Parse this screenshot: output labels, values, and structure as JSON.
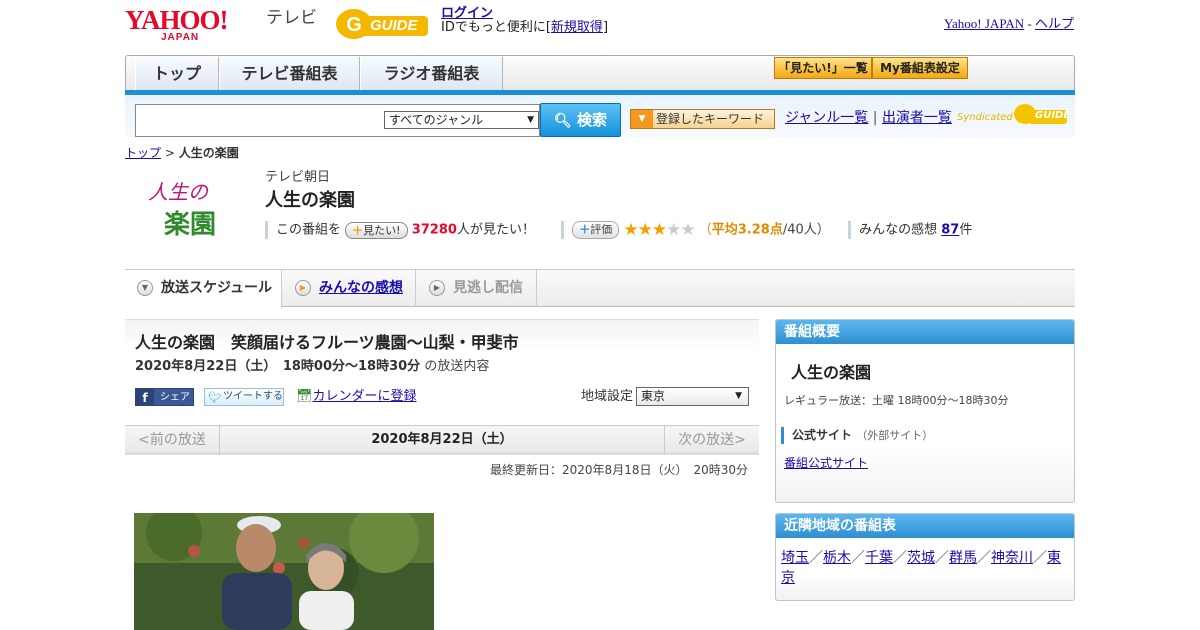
{
  "header": {
    "yahoo_logo": "YAHOO!",
    "yahoo_sub": "JAPAN",
    "tv_label": "テレビ",
    "gguide_logo": "GUIDE",
    "login": "ログイン",
    "login_prefix": "IDでもっと便利に[",
    "register": "新規取得",
    "login_suffix": "]",
    "yahoo_japan_link": "Yahoo! JAPAN",
    "separator": "-",
    "help_link": "ヘルプ"
  },
  "nav": {
    "tabs": [
      "トップ",
      "テレビ番組表",
      "ラジオ番組表"
    ],
    "mitai_list": "「見たい!」一覧",
    "my_schedule": "My番組表設定"
  },
  "search": {
    "genre_selected": "すべてのジャンル",
    "button": "検索",
    "keyword_button": "登録したキーワード",
    "genre_list": "ジャンル一覧",
    "link_separator": "|",
    "performer_list": "出演者一覧",
    "syndicated": "Syndicated",
    "gguide_mini": "GUIDE"
  },
  "breadcrumb": {
    "top": "トップ",
    "sep": ">",
    "current": "人生の楽園"
  },
  "program": {
    "logo_line1": "人生の",
    "logo_line2": "楽園",
    "station": "テレビ朝日",
    "title": "人生の楽園",
    "this_program": "この番組を",
    "mitai_button": "見たい!",
    "mitai_count": "37280",
    "mitai_suffix": "人が見たい！",
    "rating_button": "評価",
    "rating_prefix": "（",
    "rating_avg": "平均3.28点",
    "rating_suffix": "/40人）",
    "rating_value": 3.28,
    "reviews_prefix": "みんなの感想",
    "reviews_count": "87",
    "reviews_suffix": "件"
  },
  "tabs": {
    "schedule": "放送スケジュール",
    "reviews": "みんなの感想",
    "vod": "見逃し配信"
  },
  "episode": {
    "title": "人生の楽園　笑顔届けるフルーツ農園～山梨・甲斐市",
    "datetime": "2020年8月22日（土）　18時00分～18時30分",
    "datetime_suffix": "の放送内容",
    "share": "シェア",
    "tweet": "ツイートする",
    "calendar": "カレンダーに登録",
    "region_label": "地域設定",
    "region_selected": "東京",
    "prev": "<前の放送",
    "current_date": "2020年8月22日（土）",
    "next": "次の放送>",
    "updated": "最終更新日：2020年8月18日（火）　20時30分"
  },
  "sidebar": {
    "overview_header": "番組概要",
    "program_title": "人生の楽園",
    "regular": "レギュラー放送：土曜 18時00分～18時30分",
    "official_site_label": "公式サイト",
    "official_site_note": "（外部サイト）",
    "official_site_link": "番組公式サイト",
    "nearby_header": "近隣地域の番組表",
    "nearby": [
      "埼玉",
      "栃木",
      "千葉",
      "茨城",
      "群馬",
      "神奈川",
      "東京"
    ],
    "nearby_sep": "／"
  },
  "colors": {
    "yahoo_red": "#e8062a",
    "accent_blue": "#1c8fd8",
    "mitai_count": "#e8062a",
    "rating_orange": "#e48a00",
    "link": "#1a0dab"
  }
}
